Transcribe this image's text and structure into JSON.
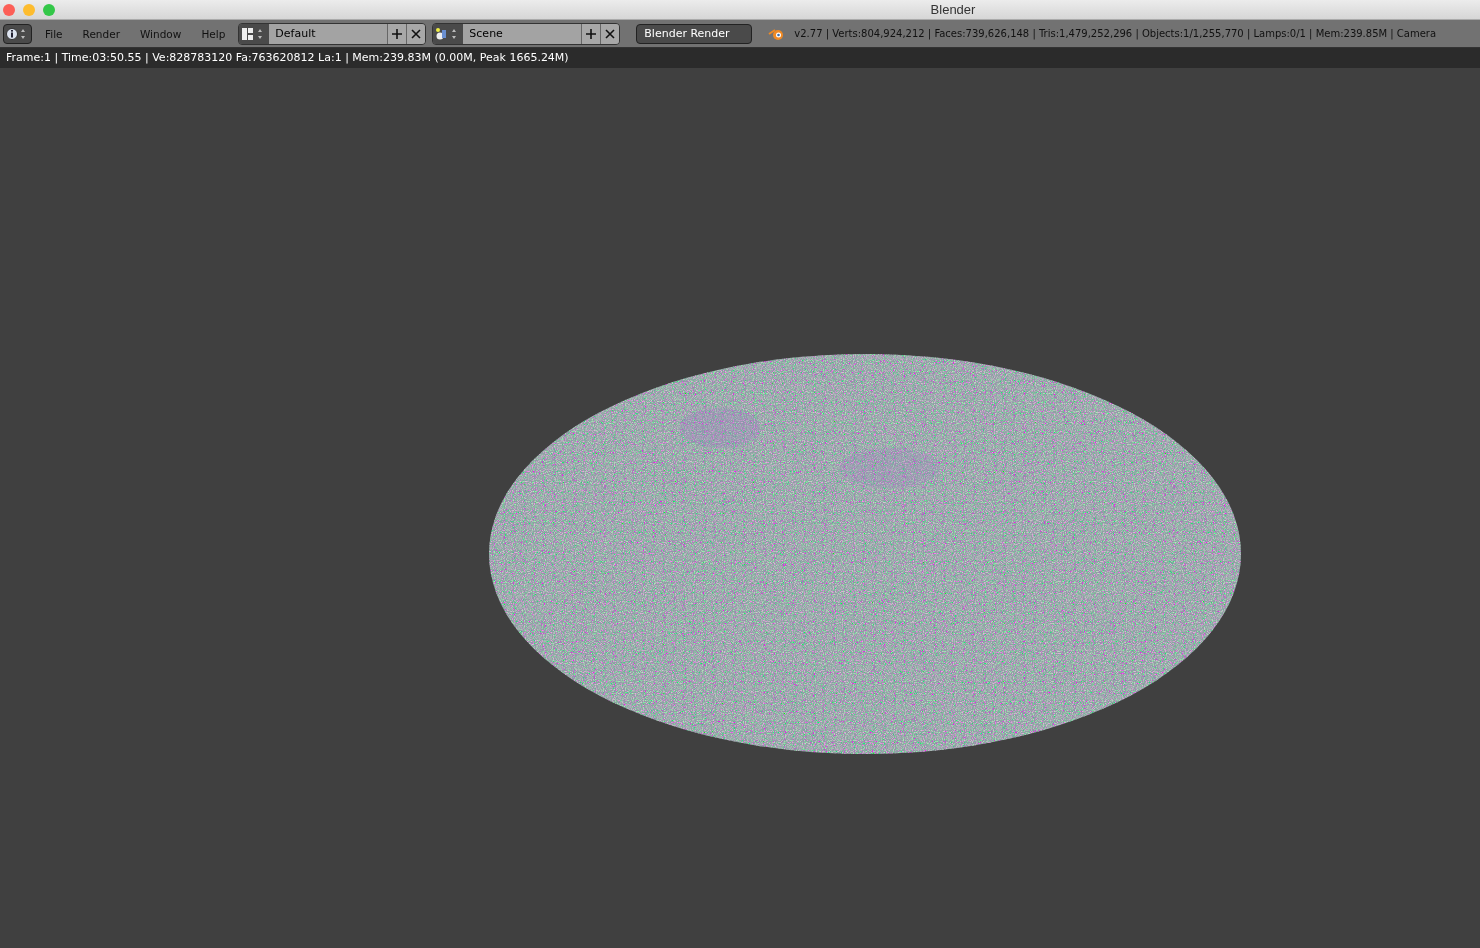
{
  "window": {
    "title": "Blender"
  },
  "header": {
    "menus": [
      "File",
      "Render",
      "Window",
      "Help"
    ],
    "screen_layout": {
      "value": "Default"
    },
    "scene": {
      "value": "Scene"
    },
    "render_engine": "Blender Render",
    "stats": "v2.77 | Verts:804,924,212 | Faces:739,626,148 | Tris:1,479,252,296 | Objects:1/1,255,770 | Lamps:0/1 | Mem:239.85M | Camera"
  },
  "render_info": "Frame:1 | Time:03:50.55 | Ve:828783120 Fa:763620812 La:1 | Mem:239.83M (0.00M, Peak 1665.24M)"
}
